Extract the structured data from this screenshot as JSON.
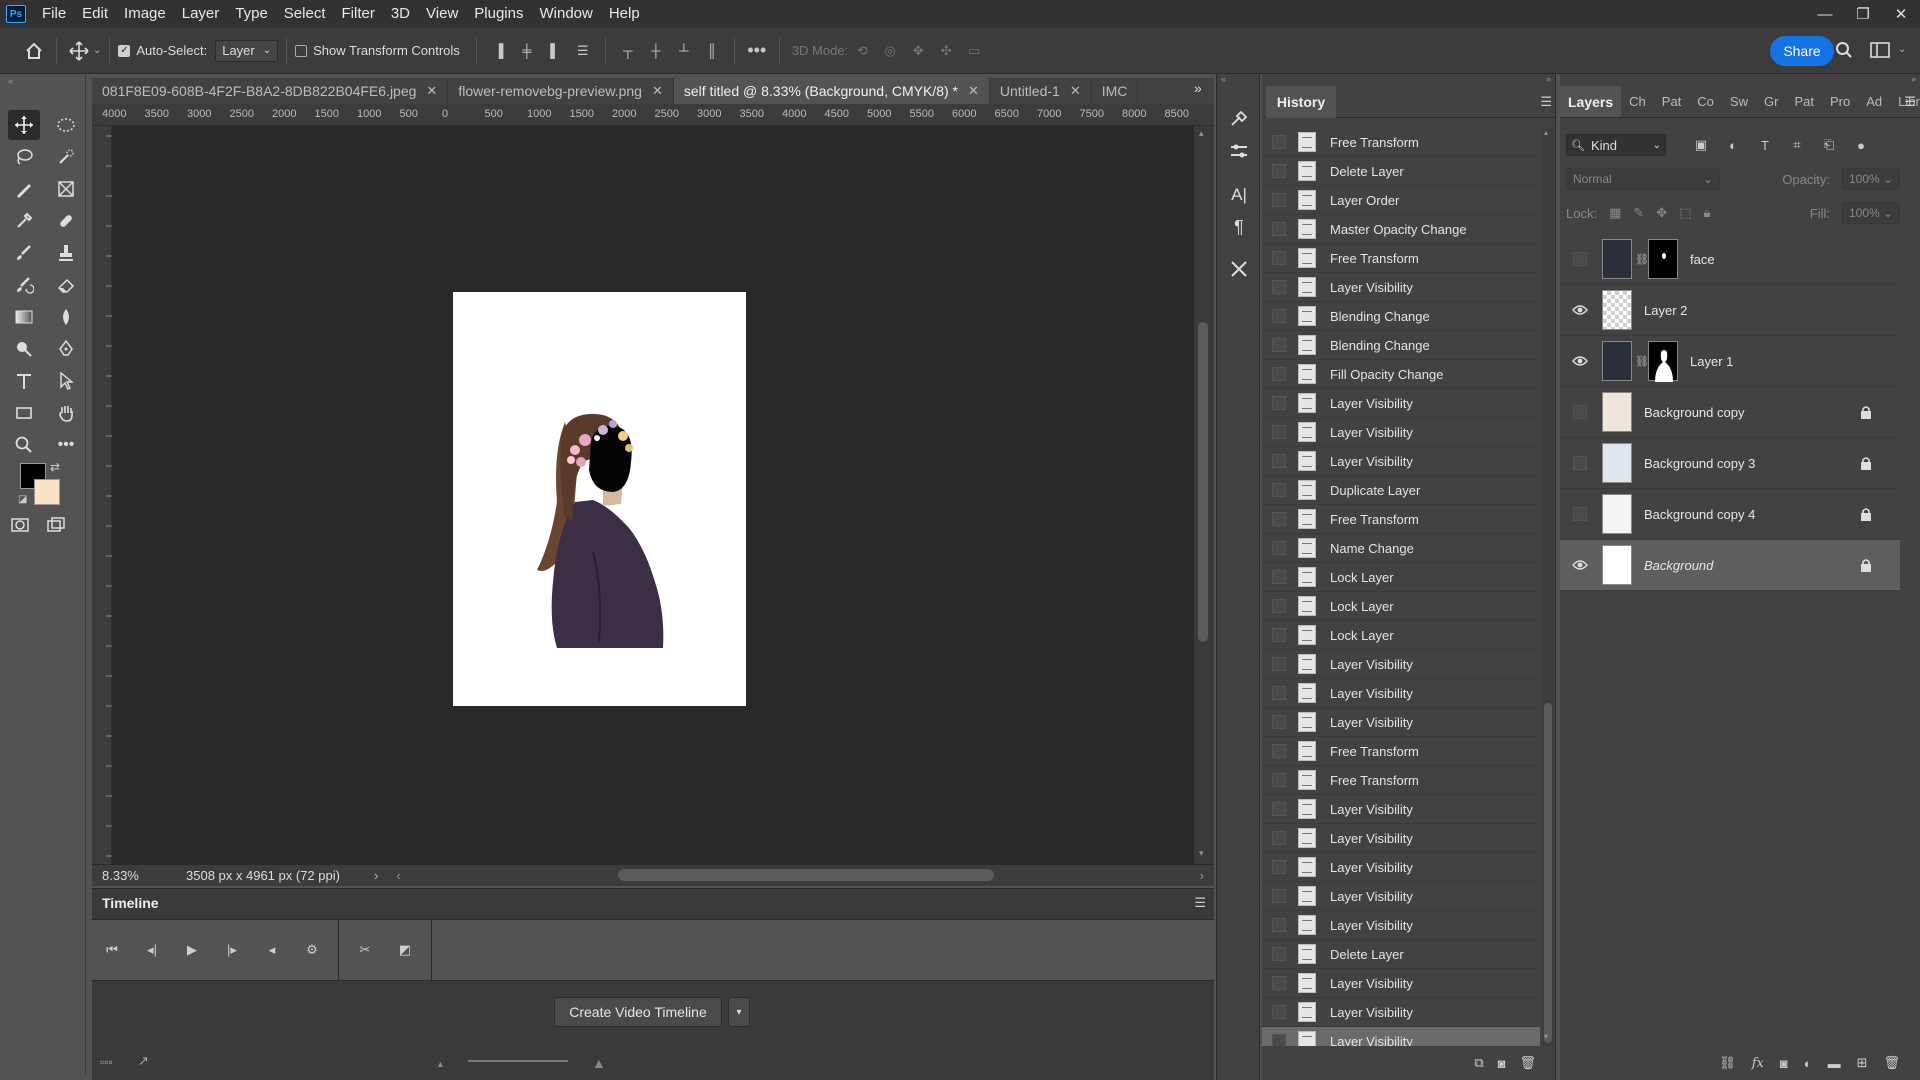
{
  "app": {
    "logo": "Ps"
  },
  "menu": [
    "File",
    "Edit",
    "Image",
    "Layer",
    "Type",
    "Select",
    "Filter",
    "3D",
    "View",
    "Plugins",
    "Window",
    "Help"
  ],
  "options": {
    "auto_select_label": "Auto-Select:",
    "auto_select_checked": true,
    "auto_select_value": "Layer",
    "show_transform_label": "Show Transform Controls",
    "show_transform_checked": false,
    "mode_3d_label": "3D Mode:",
    "share_label": "Share"
  },
  "tabs": [
    {
      "label": "081F8E09-608B-4F2F-B8A2-8DB822B04FE6.jpeg",
      "active": false
    },
    {
      "label": "flower-removebg-preview.png",
      "active": false
    },
    {
      "label": "self titled @ 8.33% (Background, CMYK/8) *",
      "active": true
    },
    {
      "label": "Untitled-1",
      "active": false
    },
    {
      "label": "IMC",
      "active": false
    }
  ],
  "ruler_top": [
    "4000",
    "3500",
    "3000",
    "2500",
    "2000",
    "1500",
    "1000",
    "500",
    "0",
    "500",
    "1000",
    "1500",
    "2000",
    "2500",
    "3000",
    "3500",
    "4000",
    "4500",
    "5000",
    "5500",
    "6000",
    "6500",
    "7000",
    "7500",
    "8000",
    "8500"
  ],
  "status": {
    "zoom": "8.33%",
    "doc_info": "3508 px x 4961 px (72 ppi)"
  },
  "timeline": {
    "title": "Timeline",
    "create_label": "Create Video Timeline"
  },
  "history": {
    "title": "History",
    "items": [
      "Free Transform",
      "Delete Layer",
      "Layer Order",
      "Master Opacity Change",
      "Free Transform",
      "Layer Visibility",
      "Blending Change",
      "Blending Change",
      "Fill Opacity Change",
      "Layer Visibility",
      "Layer Visibility",
      "Layer Visibility",
      "Duplicate Layer",
      "Free Transform",
      "Name Change",
      "Lock Layer",
      "Lock Layer",
      "Lock Layer",
      "Layer Visibility",
      "Layer Visibility",
      "Layer Visibility",
      "Free Transform",
      "Free Transform",
      "Layer Visibility",
      "Layer Visibility",
      "Layer Visibility",
      "Layer Visibility",
      "Layer Visibility",
      "Delete Layer",
      "Layer Visibility",
      "Layer Visibility",
      "Layer Visibility"
    ],
    "selected_index": 31
  },
  "layers": {
    "tabs": [
      "Layers",
      "Ch",
      "Pat",
      "Co",
      "Sw",
      "Gr",
      "Pat",
      "Pro",
      "Ad",
      "Libr"
    ],
    "kind_label": "Kind",
    "blend_mode": "Normal",
    "opacity_label": "Opacity:",
    "opacity_value": "100%",
    "lock_label": "Lock:",
    "fill_label": "Fill:",
    "fill_value": "100%",
    "items": [
      {
        "name": "face",
        "visible": false,
        "locked": false,
        "mask": true,
        "italic": false,
        "selected": false
      },
      {
        "name": "Layer 2",
        "visible": true,
        "locked": false,
        "mask": false,
        "italic": false,
        "selected": false
      },
      {
        "name": "Layer 1",
        "visible": true,
        "locked": false,
        "mask": true,
        "italic": false,
        "selected": false
      },
      {
        "name": "Background copy",
        "visible": false,
        "locked": true,
        "mask": false,
        "italic": false,
        "selected": false
      },
      {
        "name": "Background copy 3",
        "visible": false,
        "locked": true,
        "mask": false,
        "italic": false,
        "selected": false
      },
      {
        "name": "Background copy 4",
        "visible": false,
        "locked": true,
        "mask": false,
        "italic": false,
        "selected": false
      },
      {
        "name": "Background",
        "visible": true,
        "locked": true,
        "mask": false,
        "italic": true,
        "selected": true
      }
    ]
  },
  "colors": {
    "foreground": "#000000",
    "background": "#fde3c5",
    "accent": "#1473e6"
  }
}
